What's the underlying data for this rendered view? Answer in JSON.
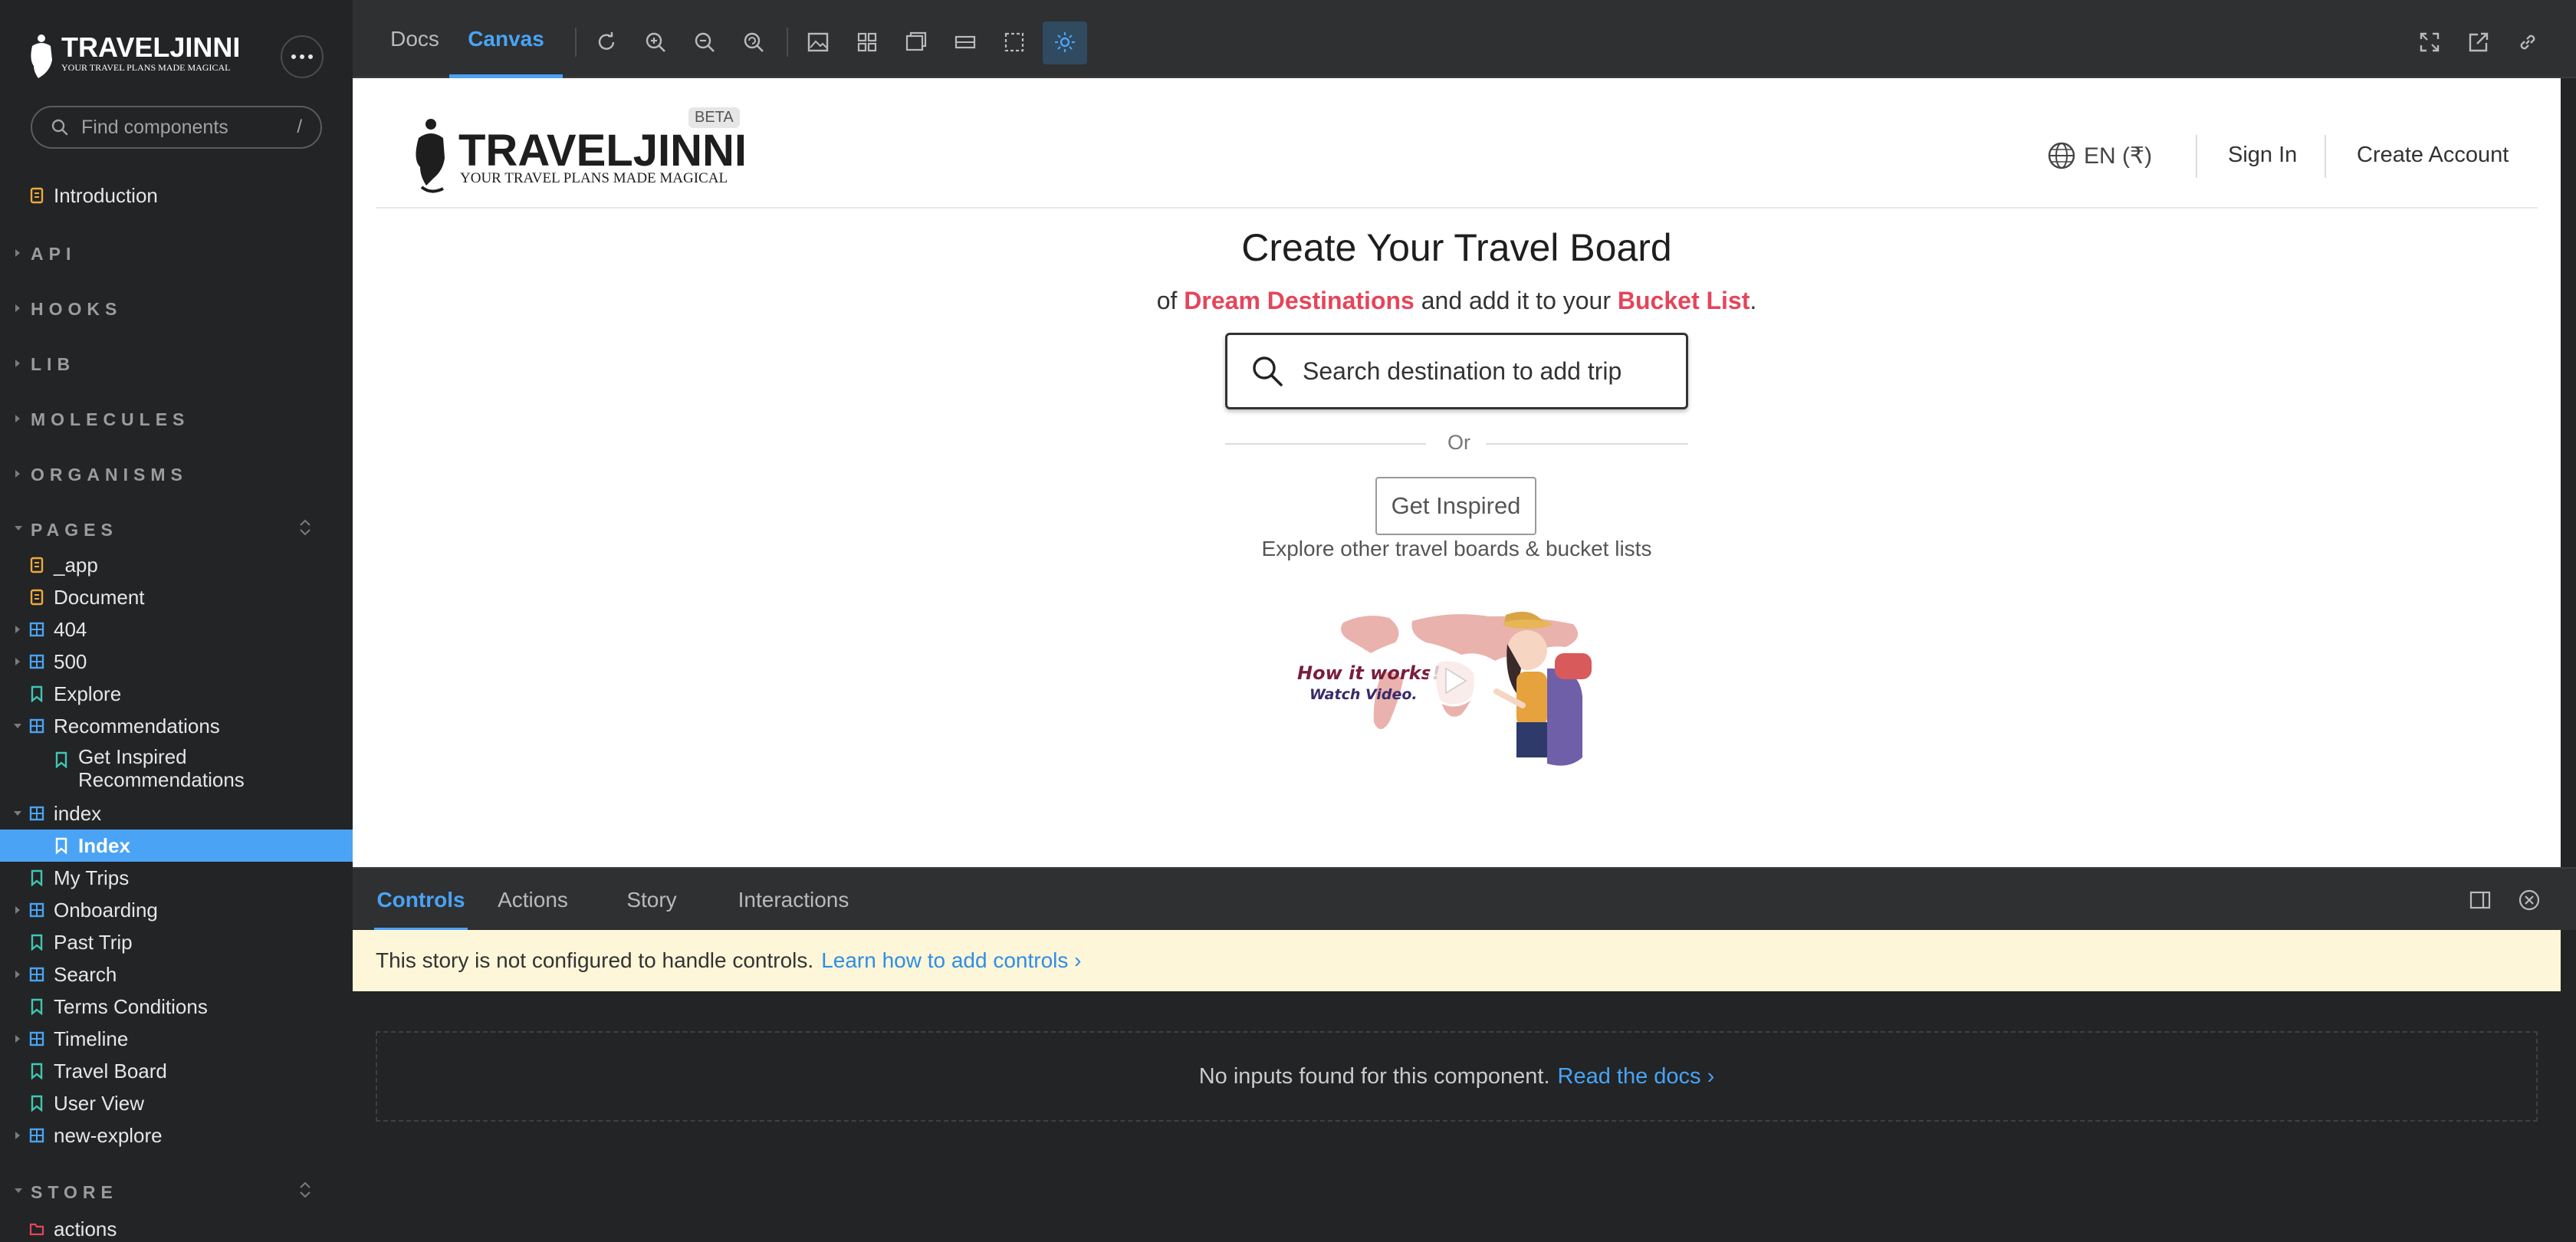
{
  "sidebar": {
    "brand": {
      "name": "TRAVELJINNI",
      "tagline": "YOUR TRAVEL PLANS MADE MAGICAL"
    },
    "search_placeholder": "Find components",
    "search_shortcut": "/",
    "intro": "Introduction",
    "sections": {
      "api": "API",
      "hooks": "HOOKS",
      "lib": "LIB",
      "molecules": "MOLECULES",
      "organisms": "ORGANISMS",
      "pages": "PAGES",
      "store": "STORE"
    },
    "pages": {
      "app": "_app",
      "document": "Document",
      "p404": "404",
      "p500": "500",
      "explore": "Explore",
      "recommendations": "Recommendations",
      "get_inspired_line1": "Get Inspired",
      "get_inspired_line2": "Recommendations",
      "index_group": "index",
      "index_story": "Index",
      "my_trips": "My Trips",
      "onboarding": "Onboarding",
      "past_trip": "Past Trip",
      "search": "Search",
      "terms": "Terms Conditions",
      "timeline": "Timeline",
      "travel_board": "Travel Board",
      "user_view": "User View",
      "new_explore": "new-explore"
    },
    "store": {
      "actions": "actions"
    }
  },
  "toolbar": {
    "tabs": {
      "docs": "Docs",
      "canvas": "Canvas"
    },
    "active_tab": "Canvas"
  },
  "canvas": {
    "logo_name": "TRAVELJINNI",
    "logo_tagline": "YOUR TRAVEL PLANS MADE MAGICAL",
    "beta": "BETA",
    "language": "EN (₹)",
    "sign_in": "Sign In",
    "create_account": "Create Account",
    "title": "Create Your Travel Board",
    "subtitle": {
      "prefix": "of",
      "dream": "Dream Destinations",
      "middle": "and add it to your",
      "bucket": "Bucket List",
      "suffix": "."
    },
    "search_placeholder": "Search destination to add trip",
    "or": "Or",
    "get_inspired": "Get Inspired",
    "explore_text": "Explore other travel boards & bucket lists",
    "video_line1": "How it works!",
    "video_line2": "Watch Video."
  },
  "addons": {
    "tabs": {
      "controls": "Controls",
      "actions": "Actions",
      "story": "Story",
      "interactions": "Interactions"
    },
    "notice_text": "This story is not configured to handle controls.",
    "notice_link": "Learn how to add controls",
    "no_inputs_text": "No inputs found for this component.",
    "no_inputs_link": "Read the docs"
  },
  "colors": {
    "accent": "#4aa3f5",
    "brand_red": "#e5455a",
    "sidebar_bg": "#222425",
    "notice_bg": "#fdf6d8"
  }
}
